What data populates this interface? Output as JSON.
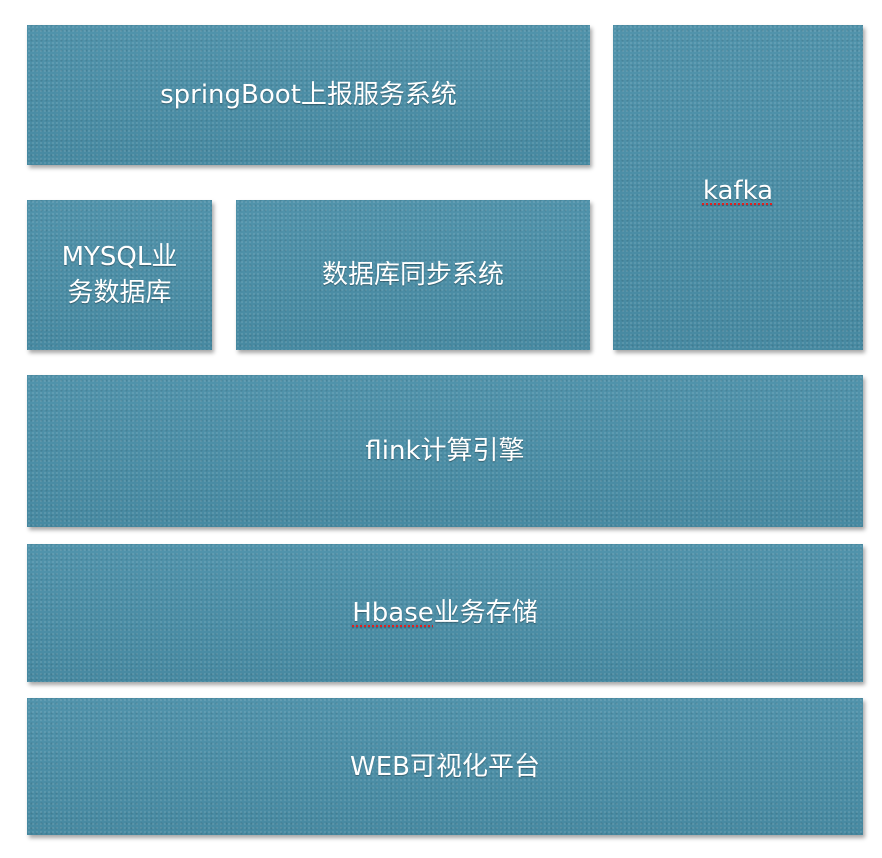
{
  "diagram": {
    "colors": {
      "box_fill": "#4a8fa8",
      "text": "#ffffff",
      "spellcheck_underline": "#e02020"
    },
    "boxes": {
      "springboot": {
        "label": "springBoot上报服务系统"
      },
      "kafka": {
        "label": "kafka"
      },
      "mysql": {
        "label": "MYSQL业\n务数据库"
      },
      "dbsync": {
        "label": "数据库同步系统"
      },
      "flink": {
        "label": "flink计算引擎"
      },
      "hbase": {
        "label_prefix": "Hbase",
        "label_suffix": "业务存储"
      },
      "web": {
        "label": "WEB可视化平台"
      }
    }
  }
}
